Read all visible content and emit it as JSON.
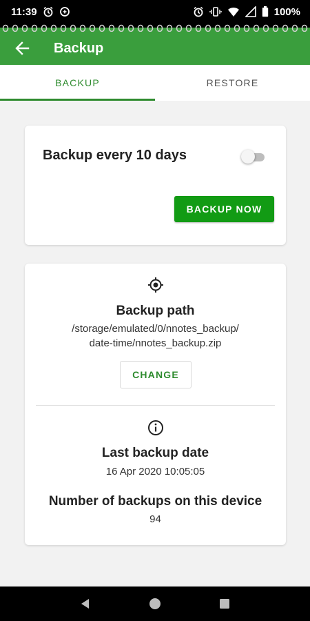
{
  "status_bar": {
    "time": "11:39",
    "battery": "100%"
  },
  "toolbar": {
    "title": "Backup",
    "back_icon": "arrow-back-icon"
  },
  "tabs": [
    {
      "label": "BACKUP",
      "active": true
    },
    {
      "label": "RESTORE",
      "active": false
    }
  ],
  "auto_backup": {
    "label": "Backup every 10 days",
    "enabled": false,
    "backup_now_label": "BACKUP NOW"
  },
  "info": {
    "path_title": "Backup path",
    "path_line1": "/storage/emulated/0/nnotes_backup/",
    "path_line2": "date-time/nnotes_backup.zip",
    "change_label": "CHANGE",
    "last_date_title": "Last backup date",
    "last_date_value": "16 Apr 2020 10:05:05",
    "count_title": "Number of backups on this device",
    "count_value": "94"
  },
  "colors": {
    "primary": "#3a9e3d",
    "accent": "#2e8b2e",
    "button": "#129b14"
  }
}
